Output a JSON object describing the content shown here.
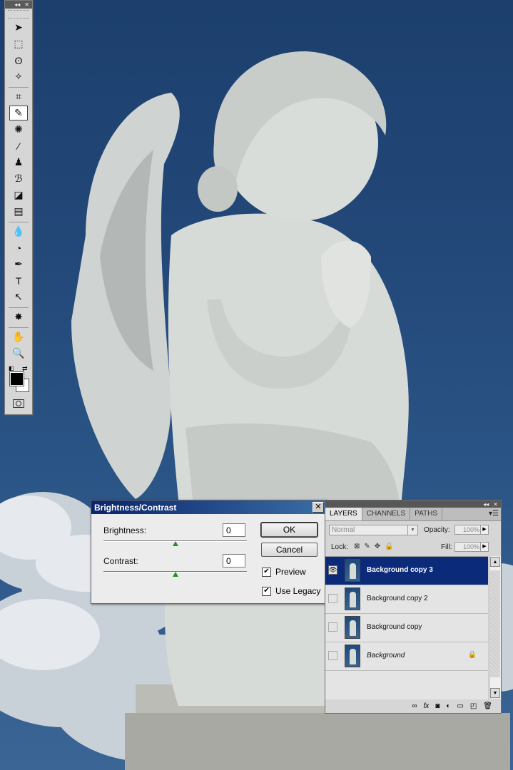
{
  "photo": {
    "subject": "angel-statue"
  },
  "tools_panel": {
    "tools": [
      {
        "name": "move-tool-icon",
        "glyph": "➤"
      },
      {
        "name": "marquee-tool-icon",
        "glyph": "⬚"
      },
      {
        "name": "lasso-tool-icon",
        "glyph": "ʘ"
      },
      {
        "name": "magic-wand-tool-icon",
        "glyph": "✧"
      },
      {
        "name": "crop-tool-icon",
        "glyph": "⌗"
      },
      {
        "name": "eyedropper-tool-icon",
        "glyph": "✎",
        "selected": true
      },
      {
        "name": "spot-healing-tool-icon",
        "glyph": "✺"
      },
      {
        "name": "brush-tool-icon",
        "glyph": "⁄"
      },
      {
        "name": "clone-stamp-tool-icon",
        "glyph": "♟"
      },
      {
        "name": "history-brush-tool-icon",
        "glyph": "ℬ"
      },
      {
        "name": "eraser-tool-icon",
        "glyph": "◪"
      },
      {
        "name": "gradient-tool-icon",
        "glyph": "▤"
      },
      {
        "name": "blur-tool-icon",
        "glyph": "💧"
      },
      {
        "name": "dodge-tool-icon",
        "glyph": "◔"
      },
      {
        "name": "pen-tool-icon",
        "glyph": "✒"
      },
      {
        "name": "type-tool-icon",
        "glyph": "T"
      },
      {
        "name": "path-selection-tool-icon",
        "glyph": "↖"
      },
      {
        "name": "custom-shape-tool-icon",
        "glyph": "✸"
      },
      {
        "name": "hand-tool-icon",
        "glyph": "✋"
      },
      {
        "name": "zoom-tool-icon",
        "glyph": "🔍"
      }
    ],
    "foreground_color": "#000000",
    "background_color": "#ffffff"
  },
  "dialog": {
    "title": "Brightness/Contrast",
    "close_glyph": "✕",
    "brightness_label": "Brightness:",
    "brightness_value": "0",
    "contrast_label": "Contrast:",
    "contrast_value": "0",
    "ok_label": "OK",
    "cancel_label": "Cancel",
    "preview_label": "Preview",
    "preview_checked": true,
    "legacy_label": "Use Legacy",
    "legacy_checked": true,
    "check_glyph": "✔"
  },
  "layers_panel": {
    "tabs": [
      "LAYERS",
      "CHANNELS",
      "PATHS"
    ],
    "active_tab": "LAYERS",
    "blend_mode": "Normal",
    "opacity_label": "Opacity:",
    "opacity_value": "100%",
    "lock_label": "Lock:",
    "fill_label": "Fill:",
    "fill_value": "100%",
    "layers": [
      {
        "name": "Background copy 3",
        "selected": true,
        "visible": true
      },
      {
        "name": "Background copy 2",
        "selected": false,
        "visible": false
      },
      {
        "name": "Background copy",
        "selected": false,
        "visible": false
      },
      {
        "name": "Background",
        "selected": false,
        "visible": false,
        "locked": true,
        "italic": true
      }
    ],
    "footer_icons": [
      "link-icon",
      "fx-icon",
      "mask-icon",
      "adjustment-icon",
      "group-folder-icon",
      "new-layer-icon",
      "trash-icon"
    ]
  },
  "colors": {
    "sky": "#23497a",
    "selection": "#0b2a79",
    "dialog_title": "#0a246a",
    "slider": "#2d8a2d"
  }
}
